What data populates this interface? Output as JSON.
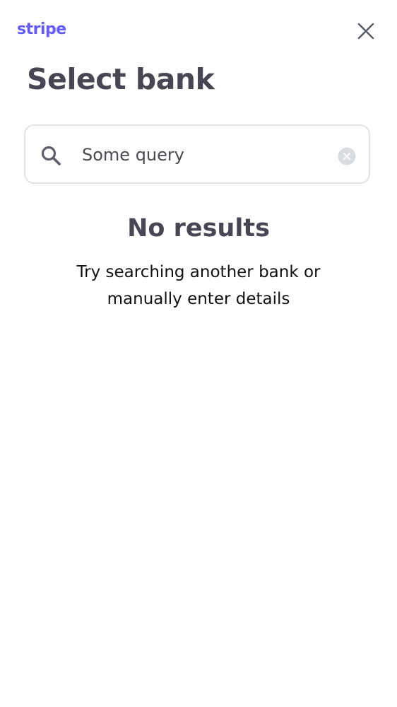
{
  "header": {
    "logo_text": "stripe",
    "close_icon": "close-icon"
  },
  "page": {
    "title": "Select bank"
  },
  "search": {
    "value": "Some query",
    "placeholder": "",
    "search_icon": "search-icon",
    "clear_icon": "clear-circle-icon"
  },
  "empty_state": {
    "heading": "No results",
    "message": "Try searching another bank or manually enter details"
  },
  "colors": {
    "brand": "#635bff",
    "title": "#474753",
    "icon": "#5c5f6b",
    "border": "#e3e3e6",
    "clear_bg": "#d9dce1",
    "text": "#111111"
  }
}
